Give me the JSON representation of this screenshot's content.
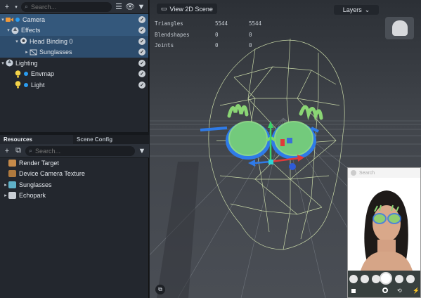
{
  "hierarchy": {
    "search_placeholder": "Search...",
    "items": [
      {
        "label": "Camera"
      },
      {
        "label": "Effects"
      },
      {
        "label": "Head Binding 0"
      },
      {
        "label": "Sunglasses"
      },
      {
        "label": "Lighting"
      },
      {
        "label": "Envmap"
      },
      {
        "label": "Light"
      }
    ]
  },
  "resources": {
    "tabs": [
      {
        "label": "Resources"
      },
      {
        "label": "Scene Config"
      }
    ],
    "search_placeholder": "Search...",
    "items": [
      {
        "label": "Render Target"
      },
      {
        "label": "Device Camera Texture"
      },
      {
        "label": "Sunglasses"
      },
      {
        "label": "Echopark"
      }
    ]
  },
  "viewport": {
    "view_2d_label": "View 2D Scene",
    "layers_label": "Layers",
    "stats": [
      {
        "name": "Triangles",
        "a": "5544",
        "b": "5544"
      },
      {
        "name": "Blendshapes",
        "a": "0",
        "b": "0"
      },
      {
        "name": "Joints",
        "a": "0",
        "b": "0"
      }
    ]
  },
  "preview": {
    "top_text": "Search"
  },
  "colors": {
    "selection": "#34587c",
    "accent_blue": "#2a9cf0",
    "glasses_green": "#7fd86a",
    "glasses_blue": "#2f7be8"
  }
}
